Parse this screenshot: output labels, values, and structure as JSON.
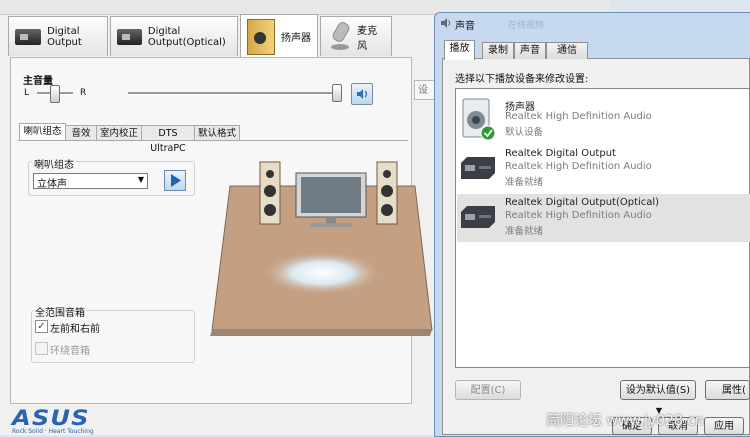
{
  "realtek": {
    "device_tabs": [
      {
        "label": "Digital Output",
        "icon": "digital-output-icon"
      },
      {
        "label": "Digital Output(Optical)",
        "icon": "digital-output-icon"
      },
      {
        "label": "扬声器",
        "icon": "speaker-icon"
      },
      {
        "label": "麦克风",
        "icon": "microphone-icon"
      }
    ],
    "main_volume": {
      "label": "主音量",
      "left": "L",
      "right": "R",
      "balance": 0.5,
      "level": 1.0
    },
    "side_button_label": "设",
    "sub_tabs": [
      "喇叭组态",
      "音效",
      "室内校正",
      "DTS UltraPC",
      "默认格式"
    ],
    "speaker_config": {
      "label": "喇叭组态",
      "selected": "立体声"
    },
    "full_range": {
      "label": "全范围音箱",
      "items": [
        {
          "label": "左前和右前",
          "checked": true,
          "enabled": true
        },
        {
          "label": "环绕音箱",
          "checked": false,
          "enabled": false
        }
      ]
    },
    "logo": {
      "brand": "ASUS",
      "tagline": "Rock Solid · Heart Touching"
    }
  },
  "sound_dialog": {
    "title": "声音",
    "title_suffix": "在线视频",
    "tabs": [
      "播放",
      "录制",
      "声音",
      "通信"
    ],
    "instruction": "选择以下播放设备来修改设置:",
    "devices": [
      {
        "name": "扬声器",
        "driver": "Realtek High Definition Audio",
        "status": "默认设备",
        "default": true,
        "selected": false
      },
      {
        "name": "Realtek Digital Output",
        "driver": "Realtek High Definition Audio",
        "status": "准备就绪",
        "default": false,
        "selected": false
      },
      {
        "name": "Realtek Digital Output(Optical)",
        "driver": "Realtek High Definition Audio",
        "status": "准备就绪",
        "default": false,
        "selected": true
      }
    ],
    "buttons": {
      "configure": "配置(C)",
      "set_default": "设为默认值(S)",
      "properties": "属性(",
      "ok": "确定",
      "cancel": "取消",
      "apply": "应用"
    }
  },
  "watermark": "简阳论坛  www.jy028.cn"
}
